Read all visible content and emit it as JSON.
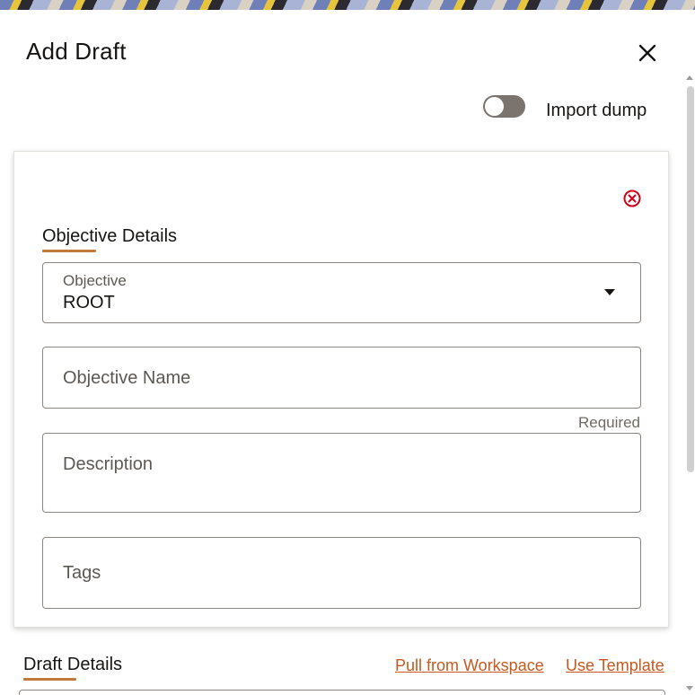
{
  "dialog": {
    "title": "Add Draft",
    "close_icon": "close-icon"
  },
  "import_dump": {
    "label": "Import dump",
    "enabled": false
  },
  "objective_details": {
    "section_title": "Objective Details",
    "remove_icon": "remove-circle-icon",
    "objective_select": {
      "label": "Objective",
      "value": "ROOT"
    },
    "objective_name": {
      "placeholder": "Objective Name",
      "helper": "Required"
    },
    "description": {
      "placeholder": "Description"
    },
    "tags": {
      "placeholder": "Tags"
    }
  },
  "draft_details": {
    "section_title": "Draft Details",
    "links": [
      "Pull from Workspace ",
      "Use Template"
    ]
  },
  "colors": {
    "accent_underline": "#c07a3c",
    "link": "#c7591e",
    "remove_icon": "#d0021b",
    "toggle_off": "#7a736e"
  }
}
